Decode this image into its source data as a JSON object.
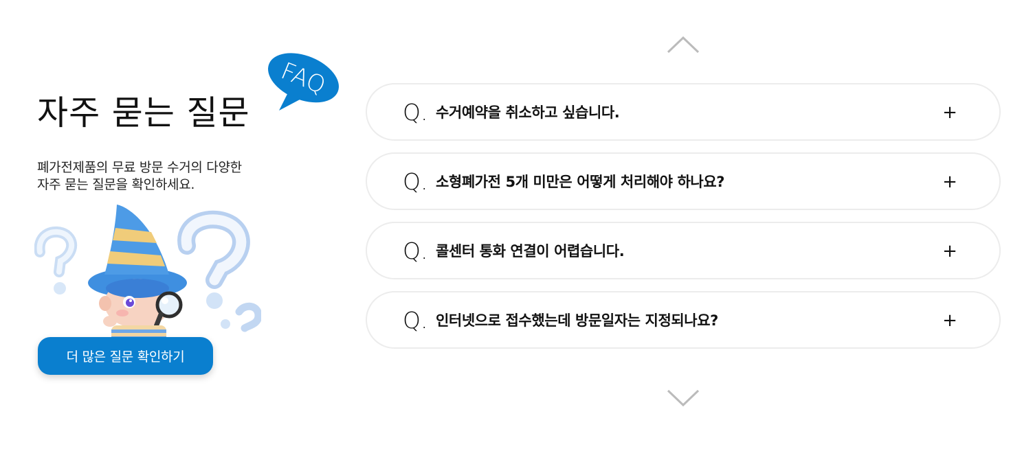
{
  "intro": {
    "badge": "FAQ",
    "title": "자주 묻는 질문",
    "subtitle_lines": [
      "폐가전제품의 무료 방문 수거의 다양한",
      "자주 묻는 질문을 확인하세요."
    ],
    "more_button_label": "더 많은 질문 확인하기"
  },
  "faq": {
    "prefix": "Q.",
    "toggle_symbol": "+",
    "items": [
      {
        "question": "수거예약을 취소하고 싶습니다."
      },
      {
        "question": "소형폐가전 5개 미만은 어떻게 처리해야 하나요?"
      },
      {
        "question": "콜센터 통화 연결이 어렵습니다."
      },
      {
        "question": "인터넷으로 접수했는데 방문일자는 지정되나요?"
      }
    ]
  },
  "colors": {
    "accent": "#0a7fcf",
    "card_border": "#ececec",
    "arrow": "#bbbbbb"
  },
  "icons": {
    "prev": "chevron-up-icon",
    "next": "chevron-down-icon",
    "badge": "speech-bubble-icon",
    "illustration": "wizard-mascot-with-magnifier"
  }
}
